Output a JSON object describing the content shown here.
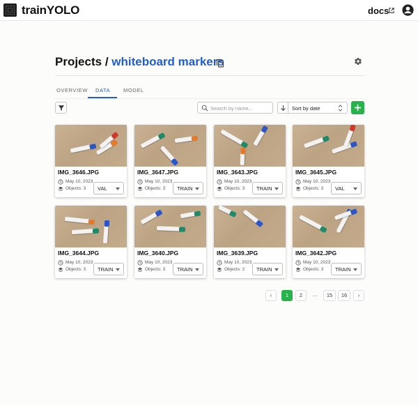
{
  "app": {
    "title": "trainYOLO",
    "docs_label": "docs"
  },
  "header": {
    "root": "Projects",
    "separator": " / ",
    "project": "whiteboard markers"
  },
  "tabs": [
    "OVERVIEW",
    "DATA",
    "MODEL"
  ],
  "toolbar": {
    "search_placeholder": "Search by name...",
    "sort_value": "Sort by date"
  },
  "images": [
    {
      "name": "IMG_3646.JPG",
      "date": "May 10, 2023",
      "objects": "Objects: 3",
      "split": "VAL"
    },
    {
      "name": "IMG_3647.JPG",
      "date": "May 10, 2023",
      "objects": "Objects: 3",
      "split": "TRAIN"
    },
    {
      "name": "IMG_3643.JPG",
      "date": "May 10, 2023",
      "objects": "Objects: 3",
      "split": "TRAIN"
    },
    {
      "name": "IMG_3645.JPG",
      "date": "May 10, 2023",
      "objects": "Objects: 3",
      "split": "VAL"
    },
    {
      "name": "IMG_3644.JPG",
      "date": "May 10, 2023",
      "objects": "Objects: 3",
      "split": "TRAIN"
    },
    {
      "name": "IMG_3640.JPG",
      "date": "May 10, 2023",
      "objects": "Objects: 3",
      "split": "TRAIN"
    },
    {
      "name": "IMG_3639.JPG",
      "date": "May 10, 2023",
      "objects": "Objects: 2",
      "split": "TRAIN"
    },
    {
      "name": "IMG_3642.JPG",
      "date": "May 10, 2023",
      "objects": "Objects: 3",
      "split": "TRAIN"
    }
  ],
  "pagination": {
    "prev": "‹",
    "pages": [
      "1",
      "2",
      "...",
      "15",
      "16"
    ],
    "next": "›",
    "current": "1"
  },
  "colors": {
    "accent": "#1f5fcf",
    "primary_button": "#28b24b"
  },
  "icons": [
    "logo-icon",
    "external-link-icon",
    "account-icon",
    "copy-icon",
    "settings-icon",
    "filter-icon",
    "search-icon",
    "sort-direction-icon",
    "add-icon",
    "clock-icon",
    "layers-icon"
  ]
}
